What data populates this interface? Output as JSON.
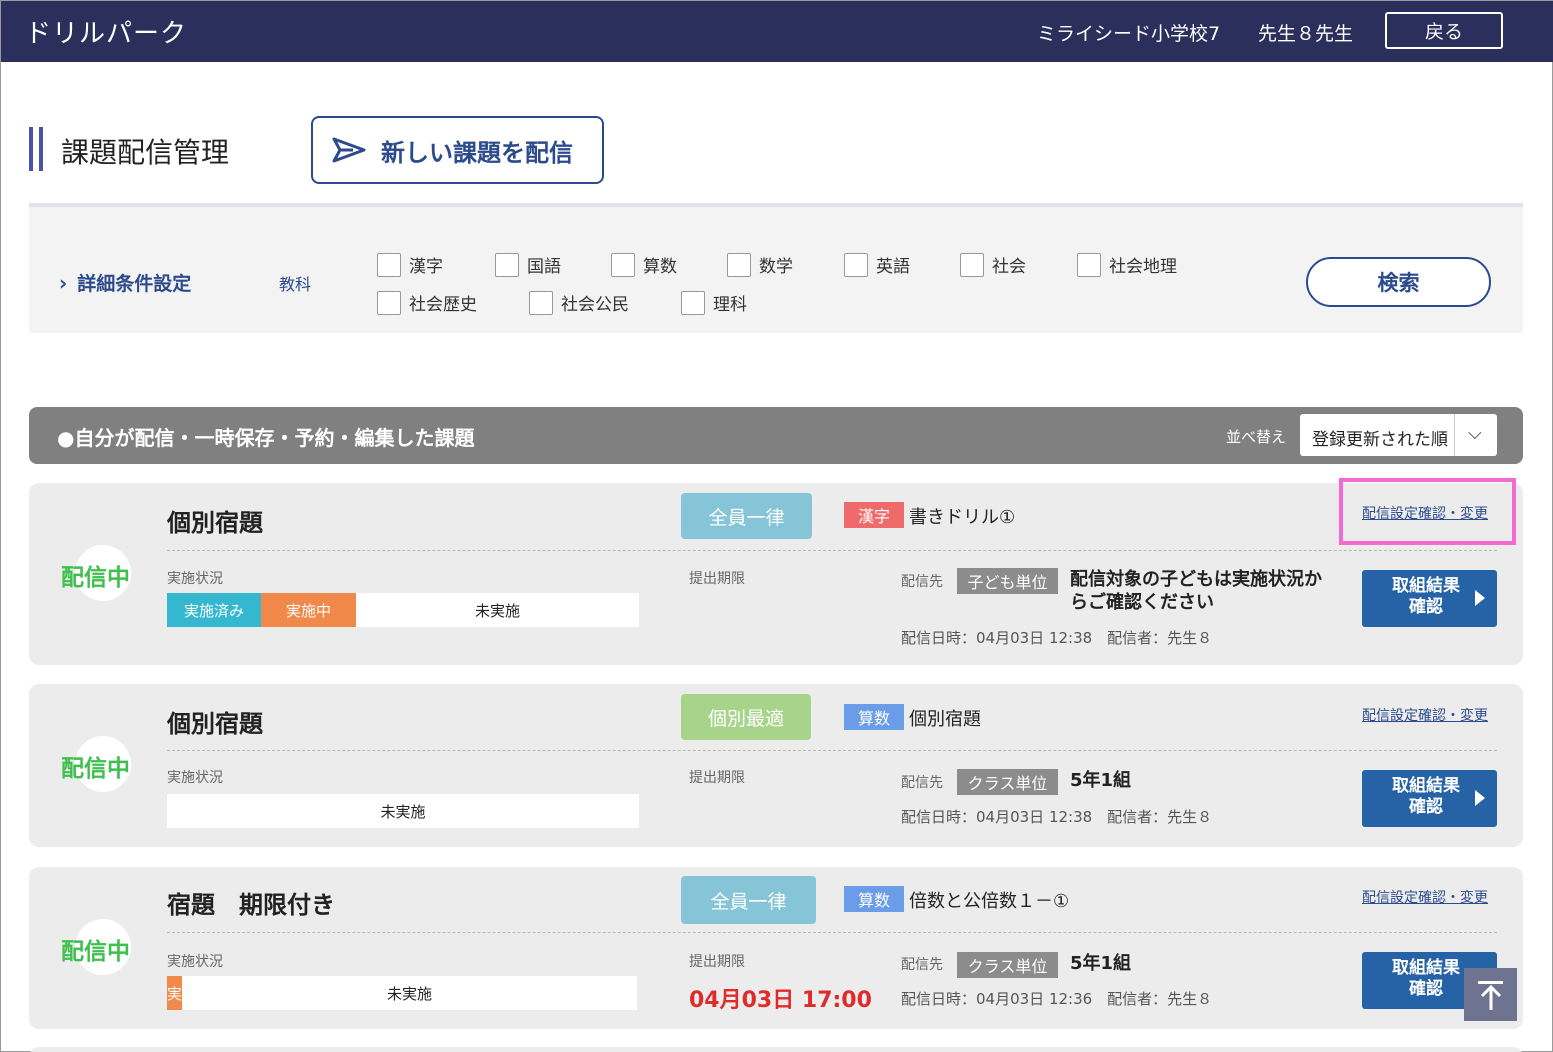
{
  "header": {
    "app_title": "ドリルパーク",
    "school": "ミライシード小学校7",
    "teacher": "先生８先生",
    "back_label": "戻る"
  },
  "page": {
    "title": "課題配信管理",
    "new_assignment_label": "新しい課題を配信"
  },
  "filter": {
    "detail_label": "詳細条件設定",
    "subject_label": "教科",
    "subjects": [
      "漢字",
      "国語",
      "算数",
      "数学",
      "英語",
      "社会",
      "社会地理",
      "社会歴史",
      "社会公民",
      "理科"
    ],
    "search_label": "検索"
  },
  "list": {
    "header_label": "●自分が配信・一時保存・予約・編集した課題",
    "sort_label": "並べ替え",
    "sort_value": "登録更新された順"
  },
  "labels": {
    "progress": "実施状況",
    "deadline": "提出期限",
    "destination": "配信先",
    "settings_link": "配信設定確認・変更",
    "result_button": "取組結果\n確認"
  },
  "cards": [
    {
      "status": "配信中",
      "title": "個別宿題",
      "mode": "全員一律",
      "subject": "漢字",
      "assignment": "書きドリル①",
      "done_label": "実施済み",
      "doing_label": "実施中",
      "not_yet_label": "未実施",
      "deadline": "",
      "unit": "子ども単位",
      "target": "配信対象の子どもは実施状況か\nらご確認ください",
      "meta": "配信日時：04月03日 12:38　配信者：先生８"
    },
    {
      "status": "配信中",
      "title": "個別宿題",
      "mode": "個別最適",
      "subject": "算数",
      "assignment": "個別宿題",
      "done_label": "",
      "doing_label": "",
      "not_yet_label": "未実施",
      "deadline": "",
      "unit": "クラス単位",
      "target": "5年1組",
      "meta": "配信日時：04月03日 12:38　配信者：先生８"
    },
    {
      "status": "配信中",
      "title": "宿題　期限付き",
      "mode": "全員一律",
      "subject": "算数",
      "assignment": "倍数と公倍数１－①",
      "done_label": "",
      "doing_label": "実",
      "not_yet_label": "未実施",
      "deadline": "04月03日 17:00",
      "unit": "クラス単位",
      "target": "5年1組",
      "meta": "配信日時：04月03日 12:36　配信者：先生８"
    }
  ],
  "colors": {
    "header_bg": "#2b2f5b",
    "accent_blue": "#2c4b8c",
    "status_green": "#3fbf4d",
    "done": "#35b8cf",
    "in_progress": "#f0894a",
    "deadline_red": "#e02b2b",
    "highlight": "#f36ad0"
  },
  "icons": {
    "new_assignment": "paper-plane-icon",
    "detail_toggle": "chevron-right-icon",
    "sort": "chevron-down-icon",
    "result": "play-triangle-icon",
    "scroll_top": "arrow-up-to-top-icon"
  }
}
